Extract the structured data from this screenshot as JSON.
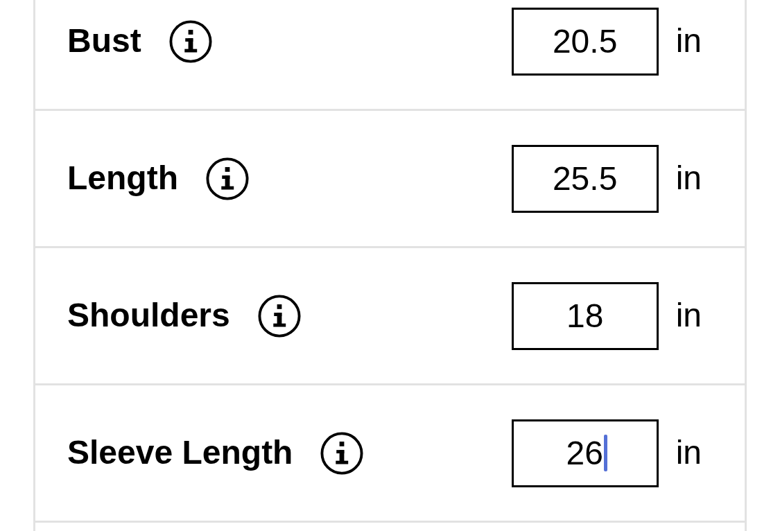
{
  "rows": [
    {
      "label": "Bust",
      "value": "20.5",
      "unit": "in",
      "focused": false
    },
    {
      "label": "Length",
      "value": "25.5",
      "unit": "in",
      "focused": false
    },
    {
      "label": "Shoulders",
      "value": "18",
      "unit": "in",
      "focused": false
    },
    {
      "label": "Sleeve Length",
      "value": "26",
      "unit": "in",
      "focused": true
    }
  ]
}
